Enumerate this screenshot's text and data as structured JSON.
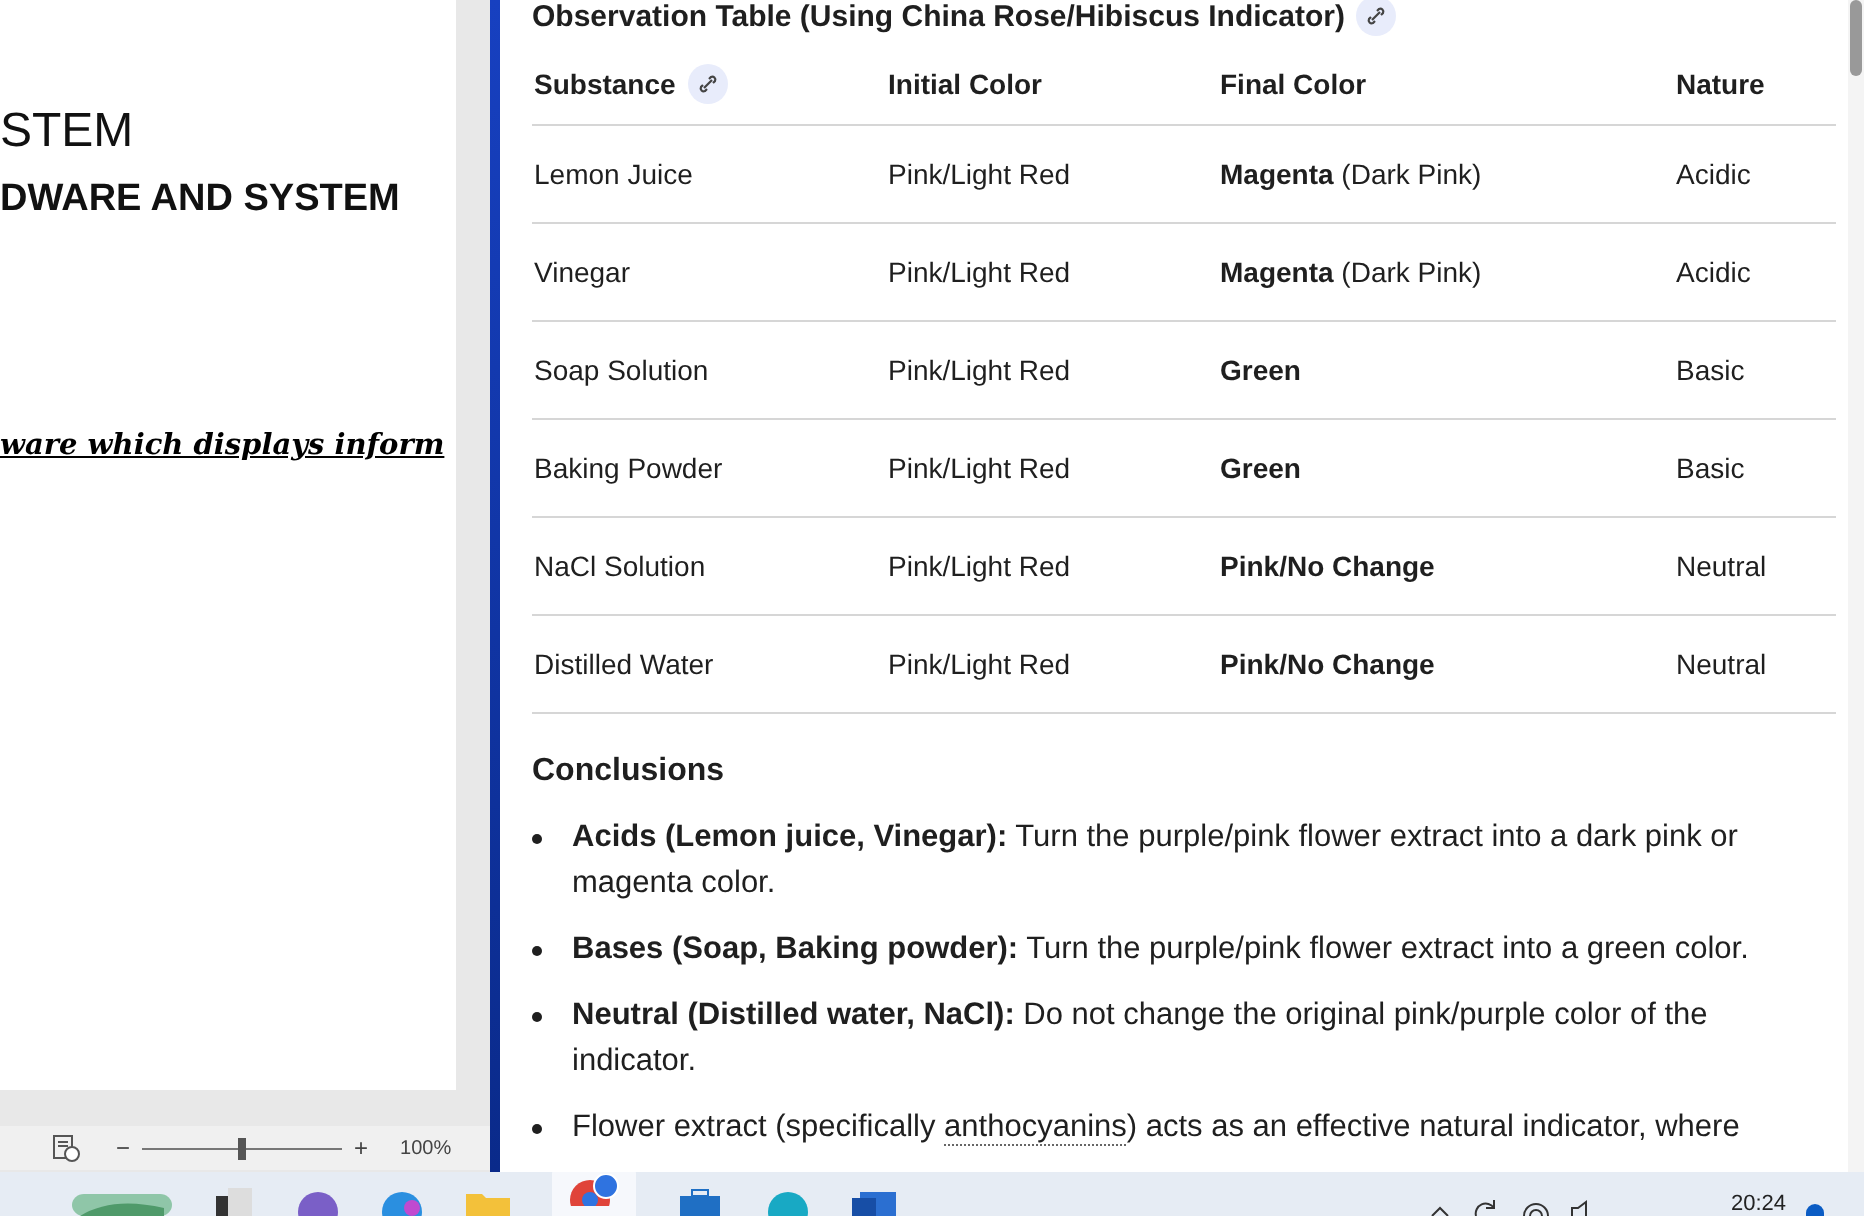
{
  "document": {
    "lines": [
      "STEM",
      "DWARE AND SYSTEM",
      "ware which displays inform"
    ],
    "status_bar": {
      "zoom_out": "−",
      "level": 0.5,
      "zoom_in": "+",
      "zoom": "100%"
    }
  },
  "article": {
    "heading": "Observation Table (Using China Rose/Hibiscus Indicator)",
    "table": {
      "columns": [
        "Substance",
        "Initial Color",
        "Final Color",
        "Nature"
      ],
      "rows": [
        {
          "substance": "Lemon Juice",
          "initial": "Pink/Light Red",
          "final": {
            "term": "Magenta",
            "note": "(Dark Pink)"
          },
          "nature": "Acidic"
        },
        {
          "substance": "Vinegar",
          "initial": "Pink/Light Red",
          "final": {
            "term": "Magenta",
            "note": "(Dark Pink)"
          },
          "nature": "Acidic"
        },
        {
          "substance": "Soap Solution",
          "initial": "Pink/Light Red",
          "final": {
            "term": "Green"
          },
          "nature": "Basic"
        },
        {
          "substance": "Baking Powder",
          "initial": "Pink/Light Red",
          "final": {
            "term": "Green"
          },
          "nature": "Basic"
        },
        {
          "substance": "NaCl Solution",
          "initial": "Pink/Light Red",
          "final": {
            "term": "Pink/No Change"
          },
          "nature": "Neutral"
        },
        {
          "substance": "Distilled Water",
          "initial": "Pink/Light Red",
          "final": {
            "term": "Pink/No Change"
          },
          "nature": "Neutral"
        }
      ]
    },
    "conclusions_title": "Conclusions",
    "conclusions": [
      {
        "text": "**Acids (Lemon juice, Vinegar):** Turn the purple/pink flower extract into a dark pink or magenta color."
      },
      {
        "text": "**Bases (Soap, Baking powder):** Turn the purple/pink flower extract into a green color."
      },
      {
        "text": "**Neutral (Distilled water, NaCl):** Do not change the original pink/purple color of the indicator."
      },
      {
        "before": "Flower extract (specifically ",
        "term": "anthocyanins",
        "after": ") acts as an effective natural indicator, where"
      }
    ]
  },
  "taskbar": {
    "time": "20:24"
  }
}
